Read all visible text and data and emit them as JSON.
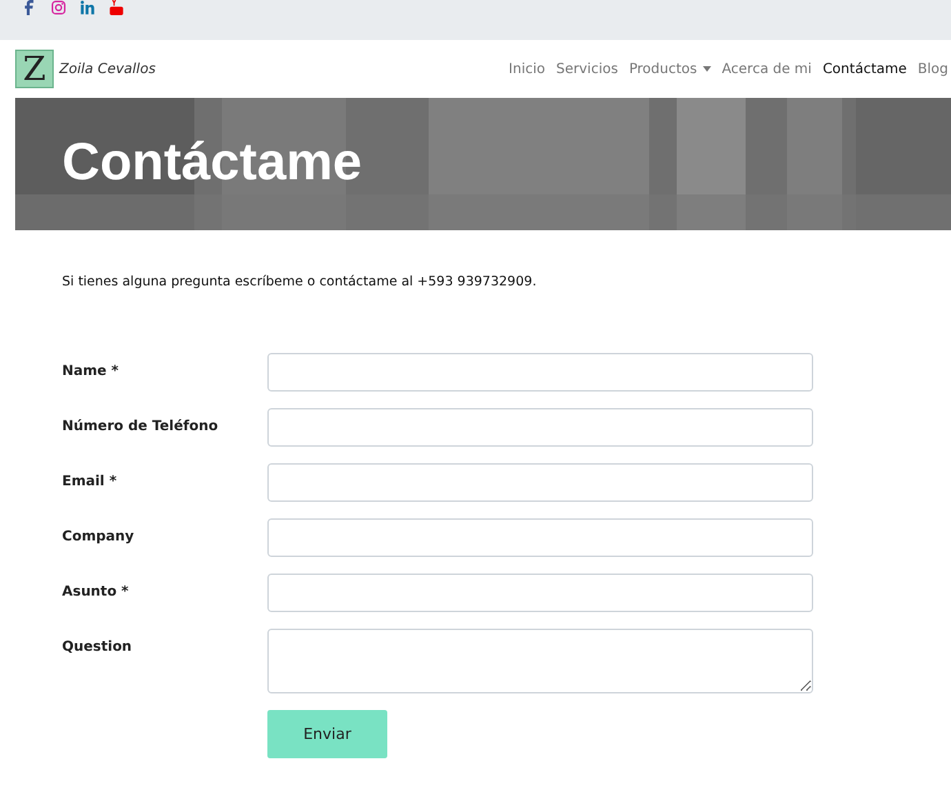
{
  "social_links": [
    {
      "kind": "facebook"
    },
    {
      "kind": "instagram"
    },
    {
      "kind": "linkedin"
    },
    {
      "kind": "youtube"
    }
  ],
  "brand": {
    "mark": "Z",
    "name": "Zoila Cevallos"
  },
  "nav": [
    {
      "label": "Inicio",
      "selected": false,
      "dropdown": false
    },
    {
      "label": "Servicios",
      "selected": false,
      "dropdown": false
    },
    {
      "label": "Productos",
      "selected": false,
      "dropdown": true
    },
    {
      "label": "Acerca de mi",
      "selected": false,
      "dropdown": false
    },
    {
      "label": "Contáctame",
      "selected": true,
      "dropdown": false
    },
    {
      "label": "Blog",
      "selected": false,
      "dropdown": false
    }
  ],
  "hero": {
    "title": "Contáctame",
    "kind": "picture"
  },
  "intro": "Si tienes alguna pregunta escríbeme o contáctame al  +593 939732909.",
  "form": {
    "fields": [
      {
        "label": "Name *",
        "kind": "input"
      },
      {
        "label": "Número de Teléfono",
        "kind": "input"
      },
      {
        "label": "Email *",
        "kind": "input"
      },
      {
        "label": "Company",
        "kind": "input"
      },
      {
        "label": "Asunto *",
        "kind": "input"
      },
      {
        "label": "Question",
        "kind": "textarea"
      }
    ],
    "submit": "Enviar"
  }
}
